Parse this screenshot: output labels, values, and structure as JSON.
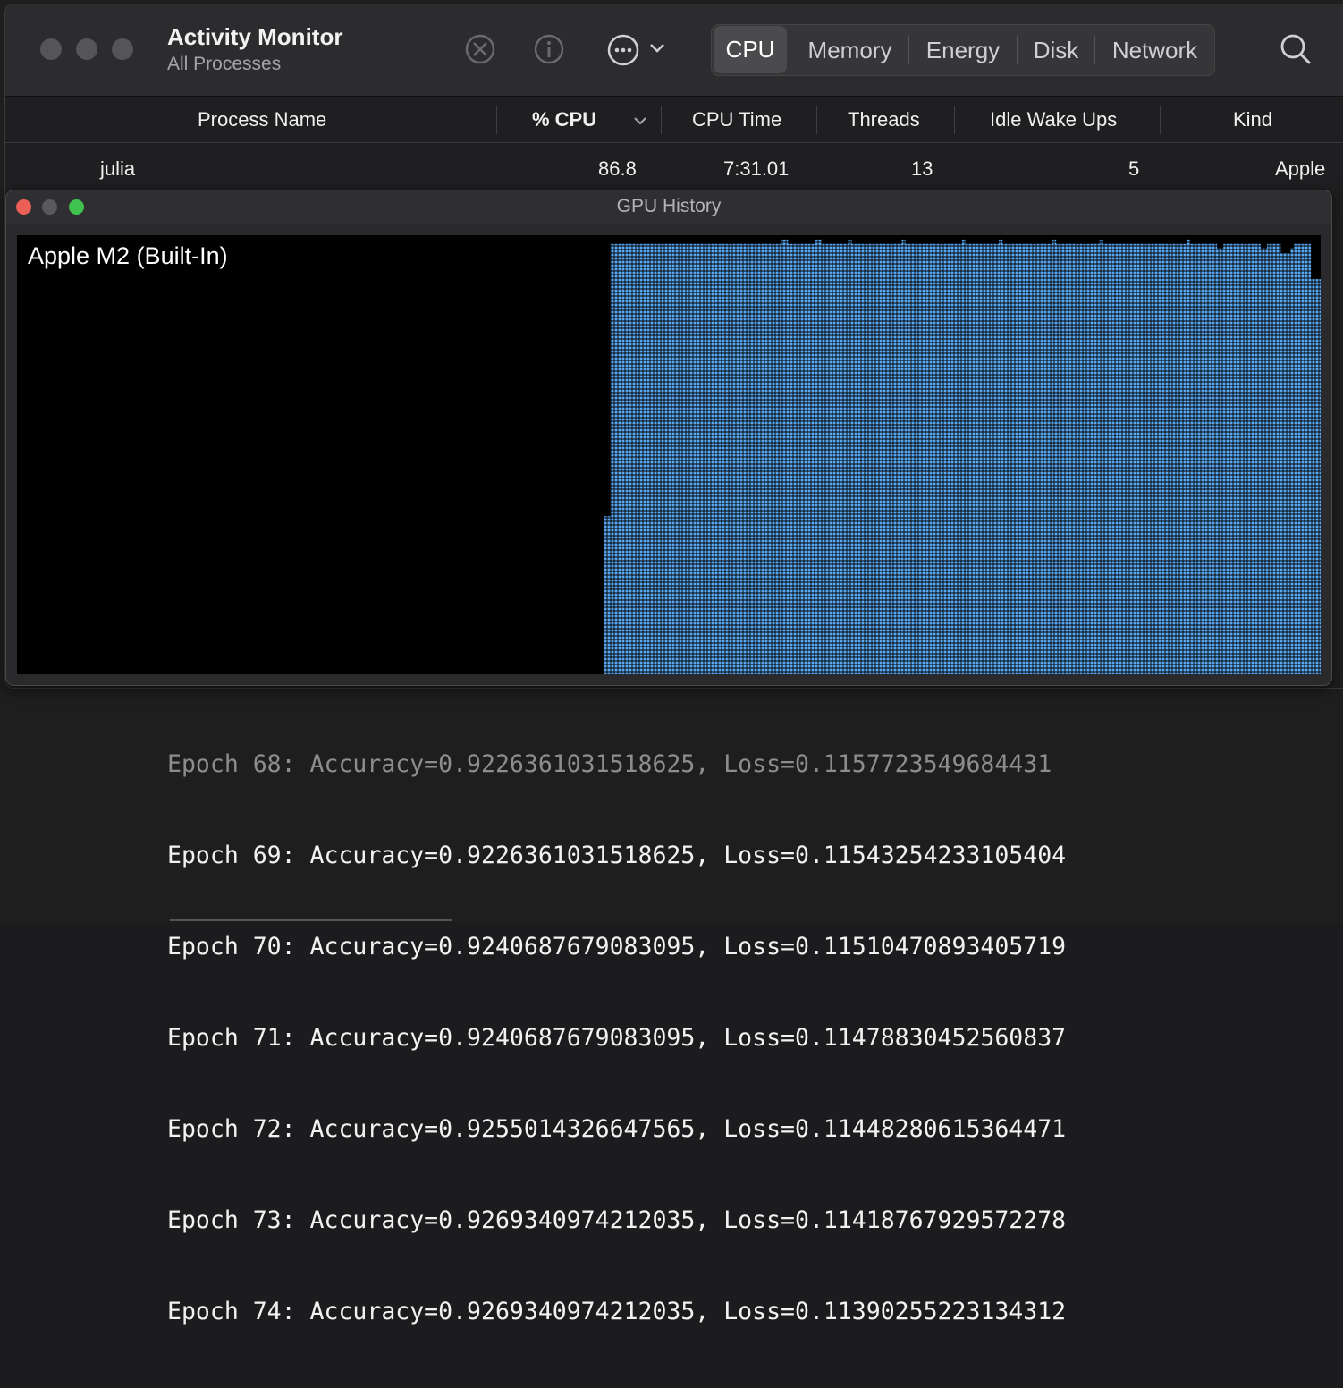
{
  "activity_monitor": {
    "title": "Activity Monitor",
    "subtitle": "All Processes",
    "tabs": [
      "CPU",
      "Memory",
      "Energy",
      "Disk",
      "Network"
    ],
    "active_tab": "CPU",
    "toolbar_icons": [
      "stop-process-icon",
      "info-icon",
      "more-actions-icon",
      "chevron-down-icon",
      "search-icon"
    ],
    "columns": [
      "Process Name",
      "% CPU",
      "CPU Time",
      "Threads",
      "Idle Wake Ups",
      "Kind"
    ],
    "sort_column": "% CPU",
    "rows": [
      {
        "name": "julia",
        "cpu": "86.8",
        "cpu_time": "7:31.01",
        "threads": "13",
        "idle_wake_ups": "5",
        "kind": "Apple"
      }
    ]
  },
  "gpu_history": {
    "window_title": "GPU History",
    "gpu_label": "Apple M2 (Built-In)",
    "bar_color": "#5aa8f0",
    "background_color": "#000000",
    "chart_data": {
      "type": "area",
      "ylim": [
        0,
        100
      ],
      "grid": true,
      "values": [
        0,
        0,
        0,
        0,
        0,
        0,
        0,
        0,
        0,
        0,
        0,
        0,
        0,
        0,
        0,
        0,
        0,
        0,
        0,
        0,
        0,
        0,
        0,
        0,
        0,
        0,
        0,
        0,
        0,
        0,
        0,
        0,
        0,
        0,
        0,
        0,
        0,
        0,
        0,
        0,
        0,
        0,
        0,
        0,
        0,
        0,
        0,
        0,
        0,
        0,
        0,
        0,
        0,
        0,
        0,
        0,
        0,
        0,
        0,
        0,
        0,
        0,
        0,
        0,
        0,
        0,
        0,
        0,
        0,
        0,
        0,
        0,
        0,
        0,
        0,
        0,
        0,
        0,
        0,
        0,
        0,
        0,
        0,
        0,
        0,
        0,
        0,
        0,
        0,
        0,
        0,
        0,
        0,
        0,
        0,
        0,
        0,
        0,
        0,
        0,
        0,
        0,
        0,
        0,
        0,
        0,
        0,
        0,
        0,
        0,
        0,
        0,
        0,
        0,
        0,
        0,
        0,
        0,
        0,
        0,
        0,
        0,
        0,
        0,
        0,
        0,
        0,
        0,
        0,
        0,
        0,
        0,
        0,
        0,
        0,
        0,
        0,
        0,
        0,
        0,
        0,
        0,
        0,
        0,
        0,
        0,
        0,
        0,
        0,
        0,
        0,
        0,
        0,
        0,
        0,
        0,
        0,
        0,
        0,
        0,
        0,
        0,
        0,
        0,
        0,
        0,
        0,
        0,
        0,
        0,
        0,
        0,
        0,
        0,
        0,
        36,
        36,
        98,
        98,
        98,
        98,
        98,
        98,
        98,
        98,
        98,
        98,
        98,
        98,
        98,
        98,
        98,
        98,
        98,
        98,
        98,
        98,
        98,
        98,
        98,
        98,
        98,
        98,
        98,
        98,
        98,
        98,
        98,
        98,
        98,
        98,
        98,
        98,
        98,
        98,
        98,
        98,
        98,
        98,
        98,
        98,
        98,
        98,
        98,
        98,
        98,
        98,
        98,
        99,
        99,
        98,
        98,
        98,
        98,
        98,
        98,
        98,
        98,
        99,
        99,
        98,
        98,
        98,
        98,
        98,
        98,
        98,
        98,
        99,
        98,
        98,
        98,
        98,
        98,
        98,
        98,
        98,
        98,
        98,
        98,
        98,
        98,
        98,
        98,
        99,
        98,
        98,
        98,
        98,
        98,
        98,
        98,
        98,
        98,
        98,
        98,
        98,
        98,
        98,
        98,
        98,
        98,
        99,
        98,
        98,
        98,
        98,
        98,
        98,
        98,
        98,
        98,
        98,
        99,
        98,
        98,
        98,
        98,
        98,
        98,
        98,
        98,
        98,
        98,
        98,
        98,
        98,
        98,
        98,
        99,
        98,
        98,
        98,
        98,
        98,
        98,
        98,
        98,
        98,
        98,
        98,
        98,
        98,
        99,
        98,
        98,
        98,
        98,
        98,
        98,
        98,
        98,
        98,
        98,
        98,
        98,
        98,
        98,
        98,
        98,
        98,
        98,
        98,
        98,
        98,
        98,
        98,
        98,
        98,
        99,
        98,
        98,
        98,
        98,
        98,
        98,
        98,
        98,
        97,
        97,
        98,
        98,
        98,
        98,
        98,
        98,
        98,
        98,
        98,
        98,
        98,
        97,
        97,
        98,
        98,
        98,
        98,
        96,
        96,
        96,
        97,
        98,
        98,
        98,
        98,
        98,
        90,
        90,
        90
      ]
    }
  },
  "terminal": {
    "lines": [
      "Epoch 68: Accuracy=0.9226361031518625, Loss=0.1157723549684431",
      "Epoch 69: Accuracy=0.9226361031518625, Loss=0.11543254233105404",
      "Epoch 70: Accuracy=0.9240687679083095, Loss=0.11510470893405719",
      "Epoch 71: Accuracy=0.9240687679083095, Loss=0.11478830452560837",
      "Epoch 72: Accuracy=0.9255014326647565, Loss=0.11448280615364471",
      "Epoch 73: Accuracy=0.9269340974212035, Loss=0.11418767929572278",
      "Epoch 74: Accuracy=0.9269340974212035, Loss=0.11390255223134312"
    ]
  }
}
